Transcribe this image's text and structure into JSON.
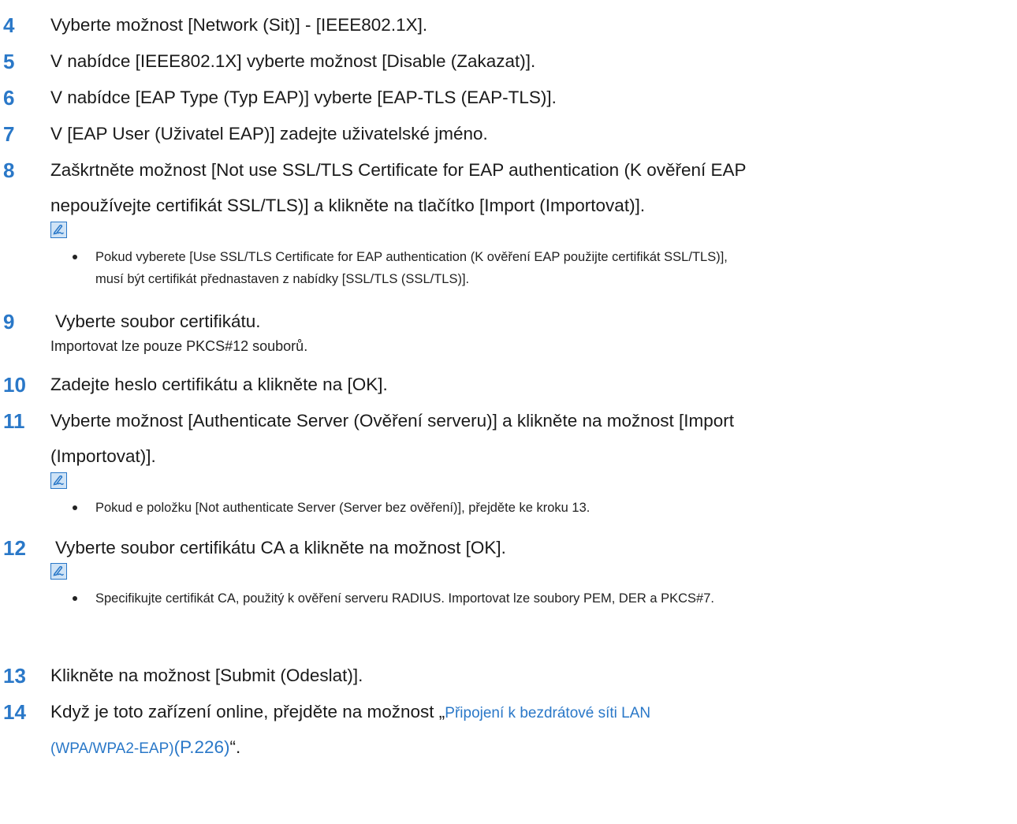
{
  "steps": [
    {
      "num": "4",
      "text": "Vyberte možnost [Network (Sit)] - [IEEE802.1X]."
    },
    {
      "num": "5",
      "text": "V nabídce [IEEE802.1X] vyberte možnost [Disable (Zakazat)]."
    },
    {
      "num": "6",
      "text": "V nabídce [EAP Type (Typ EAP)] vyberte [EAP-TLS (EAP-TLS)]."
    },
    {
      "num": "7",
      "text": "V [EAP User (Uživatel EAP)] zadejte uživatelské jméno."
    },
    {
      "num": "8",
      "line1": "Zaškrtněte možnost [Not use SSL/TLS Certificate for EAP authentication (K ověření EAP",
      "line2": "nepoužívejte certifikát SSL/TLS)] a klikněte na tlačítko [Import (Importovat)].",
      "note_line1": "Pokud vyberete [Use SSL/TLS Certificate for EAP authentication (K ověření EAP použijte certifikát SSL/TLS)],",
      "note_line2": "musí být certifikát přednastaven z nabídky [SSL/TLS (SSL/TLS)]."
    },
    {
      "num": "9",
      "text": "Vyberte soubor certifikátu.",
      "sub": "Importovat lze pouze PKCS#12 souborů."
    },
    {
      "num": "10",
      "text": "Zadejte heslo certifikátu a klikněte na [OK]."
    },
    {
      "num": "11",
      "line1": "Vyberte možnost [Authenticate Server (Ověření serveru)] a klikněte na možnost [Import",
      "line2": "(Importovat)].",
      "note": "Pokud e položku [Not authenticate Server (Server bez ověření)], přejděte ke kroku 13."
    },
    {
      "num": "12",
      "text": "Vyberte soubor certifikátu CA a klikněte na možnost [OK].",
      "note": "Specifikujte certifikát CA, použitý k ověření serveru RADIUS. Importovat lze soubory PEM, DER a PKCS#7."
    },
    {
      "num": "13",
      "text": "Klikněte na možnost [Submit (Odeslat)]."
    },
    {
      "num": "14",
      "prefix": "Když je toto zařízení online, přejděte na možnost „",
      "link1": "Připojení k bezdrátové síti LAN",
      "link2": "(WPA/WPA2-EAP)",
      "page_ref": "(P.226)",
      "suffix": "“."
    }
  ],
  "colors": {
    "step_number": "#2a78c8",
    "link": "#2a78c8",
    "memo_icon": "#2a78c8"
  },
  "icons": {
    "memo": "memo-pen-icon"
  }
}
